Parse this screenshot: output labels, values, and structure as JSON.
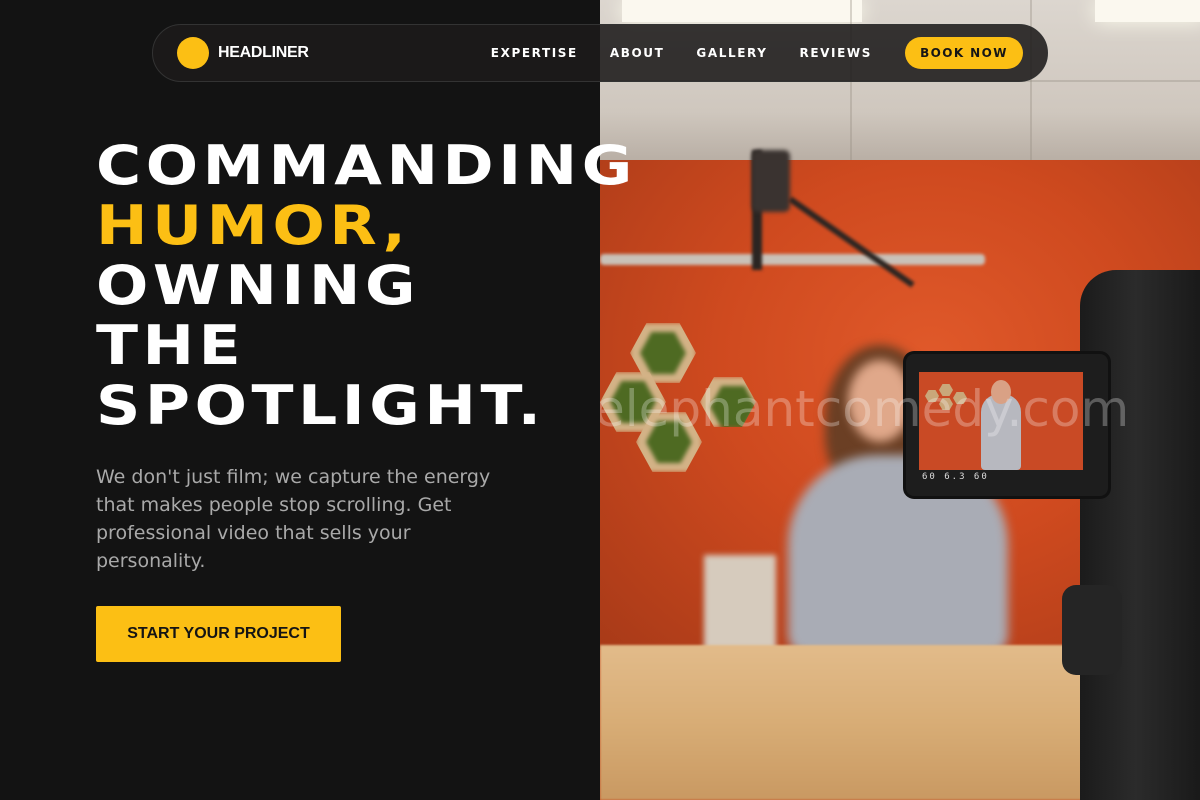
{
  "nav": {
    "brand": "HEADLINER",
    "links": [
      "EXPERTISE",
      "ABOUT",
      "GALLERY",
      "REVIEWS"
    ],
    "book_label": "BOOK NOW"
  },
  "hero": {
    "headline_lines": [
      "COMMANDING",
      "HUMOR,",
      "OWNING",
      "THE",
      "SPOTLIGHT."
    ],
    "highlight_word": "HUMOR,",
    "subtext": "We don't just film; we capture the energy that makes people stop scrolling. Get professional video that sells your personality.",
    "cta_label": "START YOUR PROJECT",
    "photo": {
      "watermark": "elephantcomedy.com",
      "camera_readout": "60  6.3  60"
    }
  },
  "colors": {
    "accent": "#fcbf14",
    "background": "#131313",
    "subtext": "#a9a9a9"
  }
}
